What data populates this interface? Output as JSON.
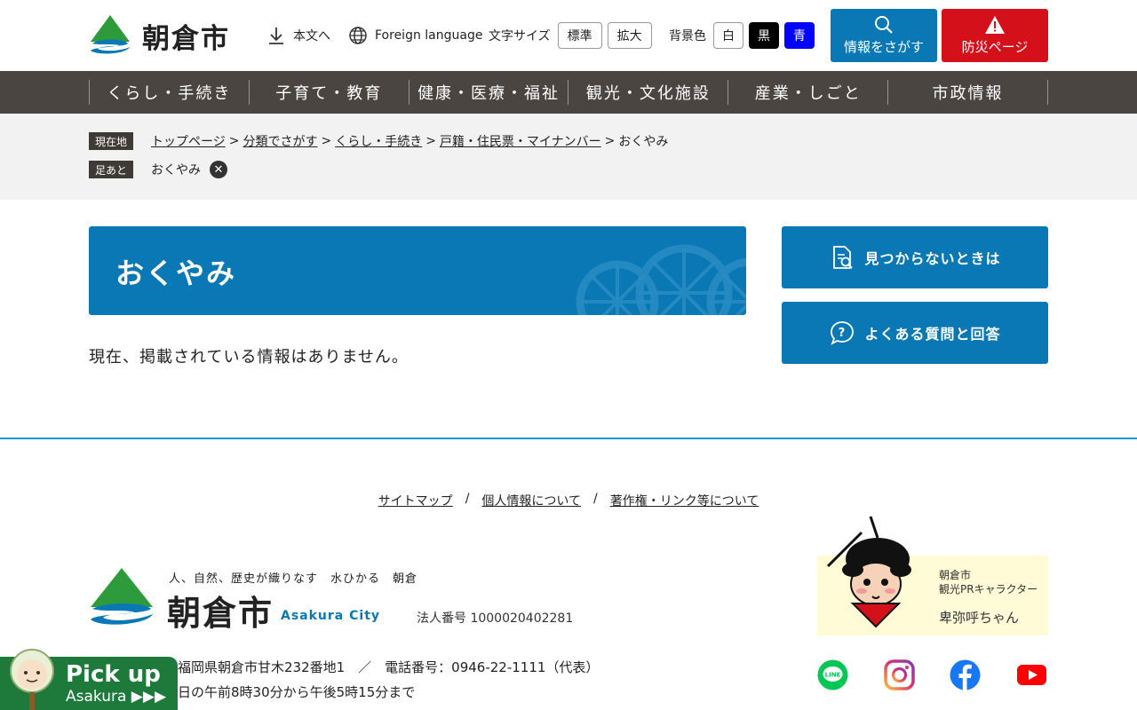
{
  "header": {
    "logo_text": "朝倉市",
    "honbun_label": "本文へ",
    "foreign_label": "Foreign language",
    "font_size_label": "文字サイズ",
    "font_standard": "標準",
    "font_large": "拡大",
    "bg_color_label": "背景色",
    "bg_white": "白",
    "bg_black": "黒",
    "bg_blue": "青",
    "search_button": "情報をさがす",
    "bousai_button": "防災ページ"
  },
  "nav": {
    "items": [
      "くらし・手続き",
      "子育て・教育",
      "健康・医療・福祉",
      "観光・文化施設",
      "産業・しごと",
      "市政情報"
    ]
  },
  "breadcrumb": {
    "current_tag": "現在地",
    "links": [
      "トップページ",
      "分類でさがす",
      "くらし・手続き",
      "戸籍・住民票・マイナンバー"
    ],
    "current": "おくやみ",
    "history_tag": "足あと",
    "history_item": "おくやみ",
    "separator": ">"
  },
  "main": {
    "title": "おくやみ",
    "message": "現在、掲載されている情報はありません。"
  },
  "side": {
    "not_found": "見つからないときは",
    "faq": "よくある質問と回答"
  },
  "footer": {
    "links": [
      "サイトマップ",
      "個人情報について",
      "著作権・リンク等について"
    ],
    "link_sep": "/",
    "catchphrase": "人、自然、歴史が織りなす　水ひかる　朝倉",
    "city_name": "朝倉市",
    "city_en": "Asakura City",
    "corp_number": "法人番号 1000020402281",
    "address": "福岡県朝倉市甘木232番地1　／　電話番号：0946-22-1111（代表）",
    "hours": "日の午前8時30分から午後5時15分まで",
    "mascot_caption": "朝倉市\n観光PRキャラクター",
    "mascot_name": "卑弥呼ちゃん"
  },
  "pickup": {
    "title": "Pick up",
    "sub": "Asakura ▶▶▶"
  },
  "colors": {
    "brand_blue": "#0a78b4",
    "alert_red": "#d4111a",
    "nav_bg": "#4a4540",
    "pickup_green": "#1d7a3a"
  }
}
